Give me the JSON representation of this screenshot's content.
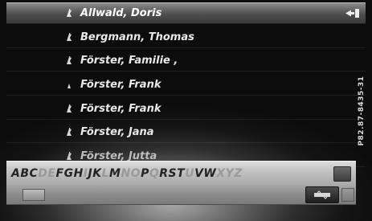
{
  "contacts": [
    {
      "name": "Allwald, Doris",
      "selected": true,
      "has_exit": true
    },
    {
      "name": "Bergmann, Thomas"
    },
    {
      "name": "Förster, Familie ,"
    },
    {
      "name": "Förster, Frank"
    },
    {
      "name": "Förster, Frank"
    },
    {
      "name": "Förster, Jana"
    },
    {
      "name": "Förster, Jutta"
    }
  ],
  "keyboard": {
    "letters": [
      {
        "char": "A",
        "active": true
      },
      {
        "char": "B",
        "active": true
      },
      {
        "char": "C",
        "active": true
      },
      {
        "char": "D",
        "active": false
      },
      {
        "char": "E",
        "active": false
      },
      {
        "char": "F",
        "active": true
      },
      {
        "char": "G",
        "active": true
      },
      {
        "char": "H",
        "active": true
      },
      {
        "char": "I",
        "active": false
      },
      {
        "char": "J",
        "active": true
      },
      {
        "char": "K",
        "active": true
      },
      {
        "char": "L",
        "active": false
      },
      {
        "char": "M",
        "active": true
      },
      {
        "char": "N",
        "active": false
      },
      {
        "char": "O",
        "active": false
      },
      {
        "char": "P",
        "active": true
      },
      {
        "char": "Q",
        "active": false
      },
      {
        "char": "R",
        "active": true
      },
      {
        "char": "S",
        "active": true
      },
      {
        "char": "T",
        "active": true
      },
      {
        "char": "U",
        "active": false
      },
      {
        "char": "V",
        "active": true
      },
      {
        "char": "W",
        "active": true
      },
      {
        "char": "X",
        "active": false
      },
      {
        "char": "Y",
        "active": false
      },
      {
        "char": "Z",
        "active": false
      }
    ]
  },
  "side_code": "P82.87-8435-31",
  "colors": {
    "highlight": "#6d6d6d",
    "keyboard_bg": "#c6c6c6",
    "text": "#e9e9e9"
  }
}
